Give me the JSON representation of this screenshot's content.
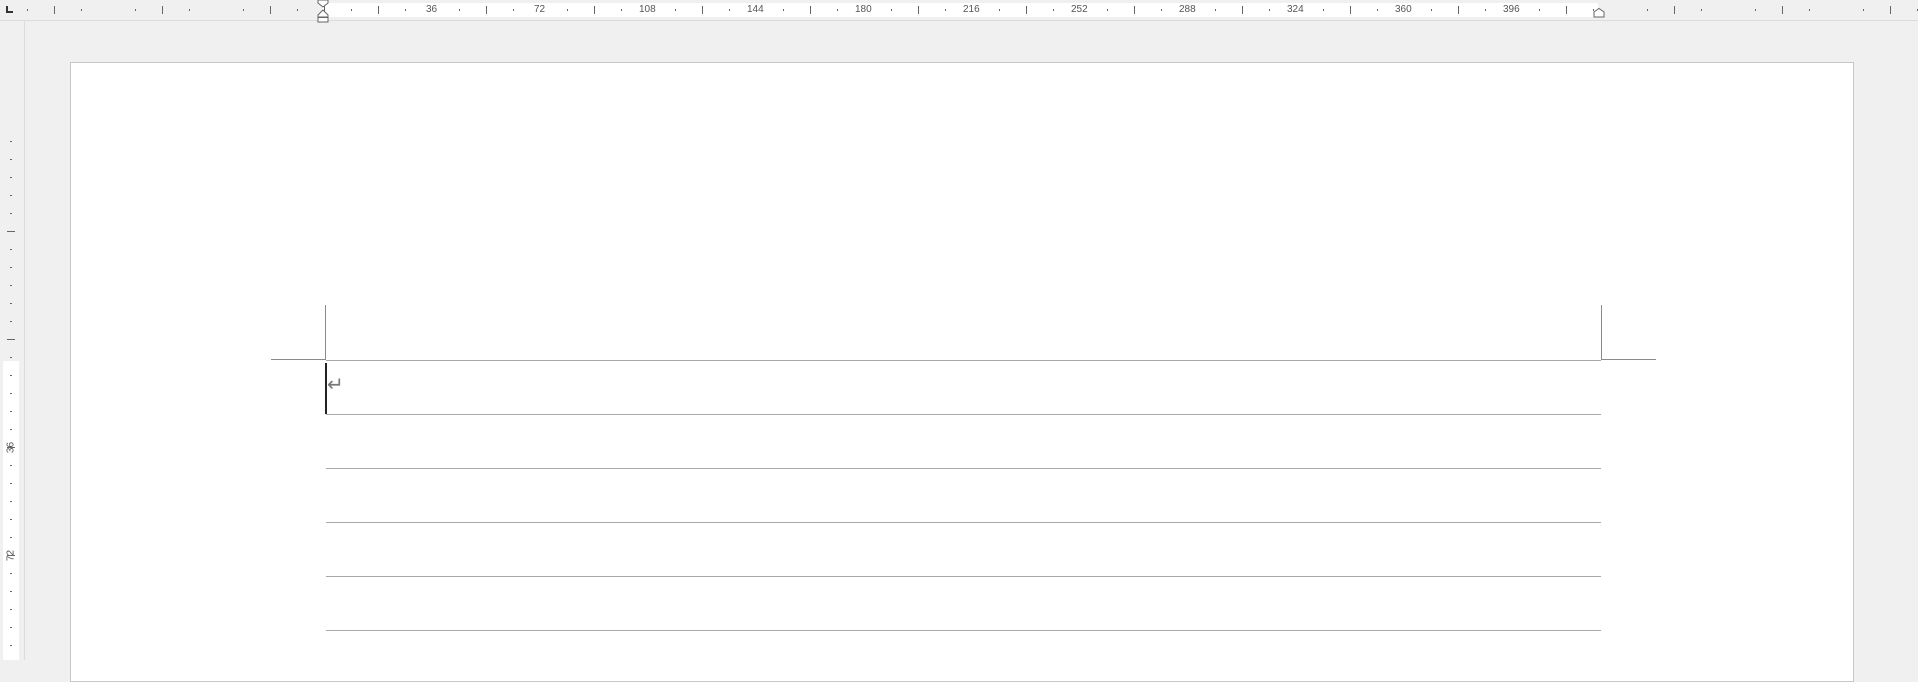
{
  "app": {
    "view": "print-layout"
  },
  "horizontal_ruler": {
    "labels": [
      "36",
      "72",
      "108",
      "144",
      "180",
      "216",
      "252",
      "288",
      "324",
      "360",
      "396"
    ]
  },
  "vertical_ruler": {
    "labels": [
      "36",
      "72"
    ]
  },
  "document": {
    "paragraph_mark": "↵",
    "ruled_line_count": 5
  },
  "colors": {
    "canvas": "#f0f0f0",
    "page": "#ffffff",
    "rule": "#a9a9a9",
    "cursor": "#222222"
  },
  "icons": {
    "tab_stop": "tab-stop-left-icon",
    "first_line_indent": "first-line-indent-icon",
    "hanging_indent": "hanging-indent-icon",
    "right_indent": "right-indent-icon"
  }
}
